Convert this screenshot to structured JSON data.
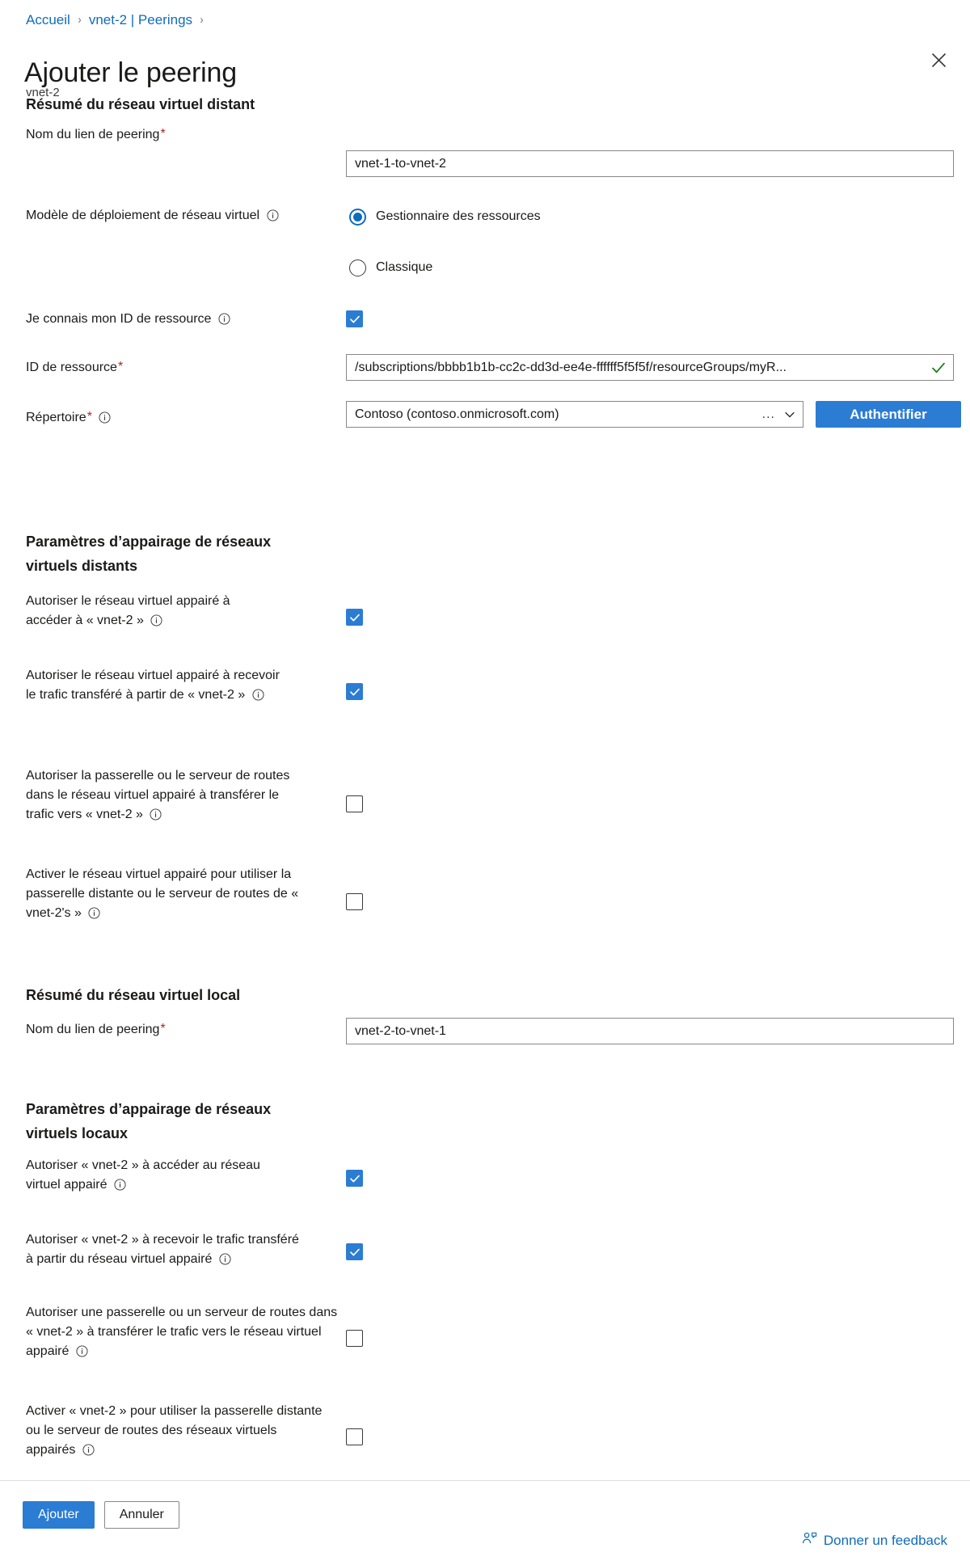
{
  "breadcrumb": {
    "items": [
      {
        "label": "Accueil"
      },
      {
        "label": "vnet-2 | Peerings"
      }
    ],
    "separator": "›"
  },
  "header": {
    "title": "Ajouter le peering",
    "subtitle": "vnet-2",
    "close_icon": "close-icon"
  },
  "remote_summary": {
    "heading": "Résumé du réseau virtuel distant",
    "peering_link_name": {
      "label": "Nom du lien de peering",
      "required": "*",
      "value": "vnet-1-to-vnet-2",
      "placeholder": "Nom du lien de peering"
    },
    "deployment_model": {
      "label": "Modèle de déploiement de réseau virtuel",
      "options": [
        {
          "label": "Gestionnaire des ressources",
          "selected": true
        },
        {
          "label": "Classique",
          "selected": false
        }
      ]
    },
    "know_resource_id": {
      "label": "Je connais mon ID de ressource",
      "checked": true
    },
    "resource_id": {
      "label": "ID de ressource",
      "required": "*",
      "value": "/subscriptions/bbbb1b1b-cc2c-dd3d-ee4e-ffffff5f5f5f/resourceGroups/myR...",
      "validated": true
    },
    "directory": {
      "label": "Répertoire",
      "required": "*",
      "value": "Contoso (contoso.onmicrosoft.com)",
      "ellipsis": "...",
      "authenticate_label": "Authentifier"
    }
  },
  "remote_peering_settings": {
    "heading": "Paramètres d’appairage de réseaux virtuels distants",
    "options": [
      {
        "label": "Autoriser le réseau virtuel appairé à accéder à « vnet-2 »",
        "checked": true
      },
      {
        "label": "Autoriser le réseau virtuel appairé à recevoir le trafic transféré à partir de « vnet-2 »",
        "checked": true
      },
      {
        "label": "Autoriser la passerelle ou le serveur de routes dans le réseau virtuel appairé à transférer le trafic vers « vnet-2 »",
        "checked": false
      },
      {
        "label": "Activer le réseau virtuel appairé pour utiliser la passerelle distante ou le serveur de routes de « vnet-2's »",
        "checked": false
      }
    ]
  },
  "local_summary": {
    "heading": "Résumé du réseau virtuel local",
    "peering_link_name": {
      "label": "Nom du lien de peering",
      "required": "*",
      "value": "vnet-2-to-vnet-1",
      "placeholder": "Nom du lien de peering"
    }
  },
  "local_peering_settings": {
    "heading": "Paramètres d’appairage de réseaux virtuels locaux",
    "options": [
      {
        "label": "Autoriser « vnet-2 » à accéder au réseau virtuel appairé",
        "checked": true
      },
      {
        "label": "Autoriser « vnet-2 » à recevoir le trafic transféré à partir du réseau virtuel appairé",
        "checked": true
      },
      {
        "label": "Autoriser une passerelle ou un serveur de routes dans « vnet-2 » à transférer le trafic vers le réseau virtuel appairé",
        "checked": false
      },
      {
        "label": "Activer « vnet-2 » pour utiliser la passerelle distante ou le serveur de routes des réseaux virtuels appairés",
        "checked": false
      }
    ]
  },
  "footer": {
    "add_label": "Ajouter",
    "cancel_label": "Annuler",
    "feedback_label": "Donner un feedback",
    "feedback_icon": "person-feedback-icon"
  },
  "colors": {
    "accent": "#2b7cd3",
    "link": "#0f6cbd",
    "required": "#a4262c",
    "valid": "#107c10"
  }
}
